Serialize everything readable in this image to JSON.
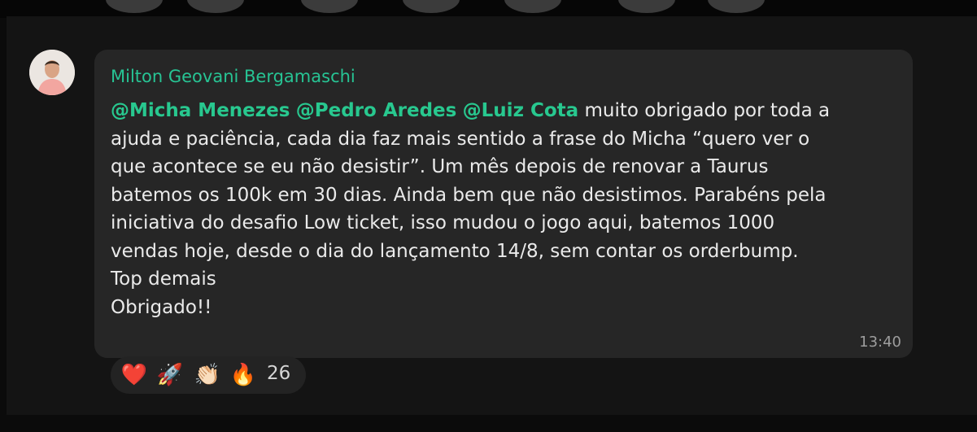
{
  "message": {
    "sender_name": "Milton Geovani Bergamaschi",
    "mentions": [
      "@Micha Menezes",
      "@Pedro Aredes",
      "@Luiz Cota"
    ],
    "lines": [
      "muito obrigado por toda a",
      "ajuda e paciência, cada dia faz mais sentido a frase do Micha “quero ver o",
      "que acontece se eu não desistir”. Um mês depois de renovar a Taurus",
      "batemos os 100k em 30 dias. Ainda bem que não desistimos. Parabéns pela",
      "iniciativa do desafio Low ticket, isso mudou o jogo aqui, batemos 1000",
      "vendas hoje, desde o dia do lançamento 14/8, sem contar os orderbump.",
      "Top demais",
      "Obrigado!!"
    ],
    "timestamp": "13:40"
  },
  "reactions": {
    "emojis": [
      "❤️",
      "🚀",
      "👏🏻",
      "🔥"
    ],
    "count": "26"
  },
  "colors": {
    "mention": "#28c88f",
    "sender": "#27c494",
    "bubble": "#262626",
    "background": "#141414"
  }
}
